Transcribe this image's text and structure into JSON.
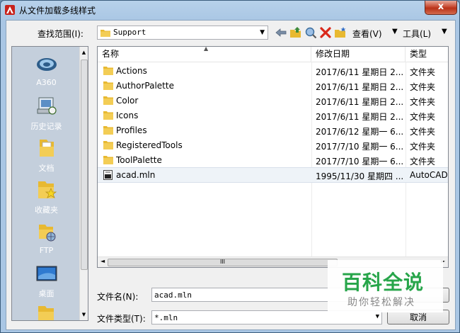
{
  "window": {
    "title": "从文件加载多线样式",
    "close_glyph": "x"
  },
  "toolbar": {
    "lookin_label": "查找范围(I):",
    "lookin_value": "Support",
    "views_label": "查看(V)",
    "tools_label": "工具(L)"
  },
  "places": [
    {
      "label": "A360",
      "icon": "a360-icon"
    },
    {
      "label": "历史记录",
      "icon": "history-icon"
    },
    {
      "label": "文档",
      "icon": "documents-icon"
    },
    {
      "label": "收藏夹",
      "icon": "favorites-icon"
    },
    {
      "label": "FTP",
      "icon": "ftp-icon"
    },
    {
      "label": "桌面",
      "icon": "desktop-icon"
    }
  ],
  "filelist": {
    "columns": {
      "name": "名称",
      "date": "修改日期",
      "type": "类型"
    },
    "rows": [
      {
        "name": "Actions",
        "date": "2017/6/11 星期日 2...",
        "type": "文件夹",
        "kind": "folder"
      },
      {
        "name": "AuthorPalette",
        "date": "2017/6/11 星期日 2...",
        "type": "文件夹",
        "kind": "folder"
      },
      {
        "name": "Color",
        "date": "2017/6/11 星期日 2...",
        "type": "文件夹",
        "kind": "folder"
      },
      {
        "name": "Icons",
        "date": "2017/6/11 星期日 2...",
        "type": "文件夹",
        "kind": "folder"
      },
      {
        "name": "Profiles",
        "date": "2017/6/12 星期一 6...",
        "type": "文件夹",
        "kind": "folder"
      },
      {
        "name": "RegisteredTools",
        "date": "2017/7/10 星期一 6...",
        "type": "文件夹",
        "kind": "folder"
      },
      {
        "name": "ToolPalette",
        "date": "2017/7/10 星期一 6...",
        "type": "文件夹",
        "kind": "folder"
      },
      {
        "name": "acad.mln",
        "date": "1995/11/30 星期四 ...",
        "type": "AutoCAD",
        "kind": "file"
      }
    ],
    "scroll_grip": "III"
  },
  "form": {
    "filename_label": "文件名(N):",
    "filename_value": "acad.mln",
    "filetype_label": "文件类型(T):",
    "filetype_value": "*.mln",
    "cancel_label": "取消"
  },
  "watermark": {
    "big": "百科全说",
    "small": "助你轻松解决"
  },
  "colors": {
    "folder": "#e8b931",
    "watermark_green": "#27a54a"
  }
}
